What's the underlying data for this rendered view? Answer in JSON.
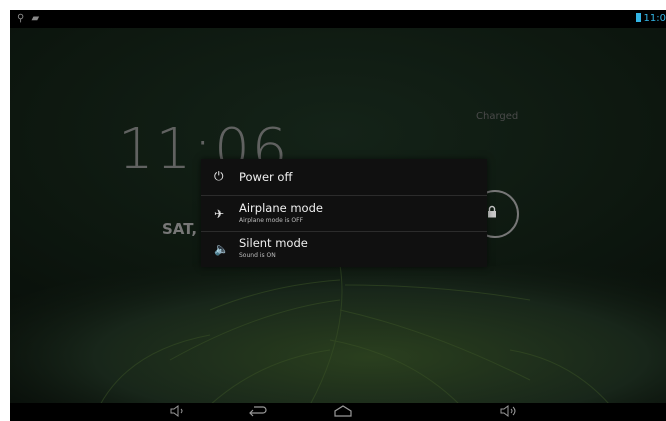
{
  "status_bar": {
    "left_icons": [
      "usb-icon",
      "android-debug-icon"
    ],
    "clock_text": "11:0"
  },
  "lockscreen": {
    "clock_fragment": "11:06",
    "date_fragment": "SAT,",
    "charge_status": "Charged"
  },
  "power_menu": {
    "items": [
      {
        "icon": "power-icon",
        "title": "Power off",
        "subtitle": ""
      },
      {
        "icon": "airplane-icon",
        "title": "Airplane mode",
        "subtitle": "Airplane mode is OFF"
      },
      {
        "icon": "speaker-icon",
        "title": "Silent mode",
        "subtitle": "Sound is ON"
      }
    ]
  },
  "nav_bar": {
    "buttons": [
      "volume-down-icon",
      "back-icon",
      "home-icon",
      "volume-up-icon"
    ]
  }
}
